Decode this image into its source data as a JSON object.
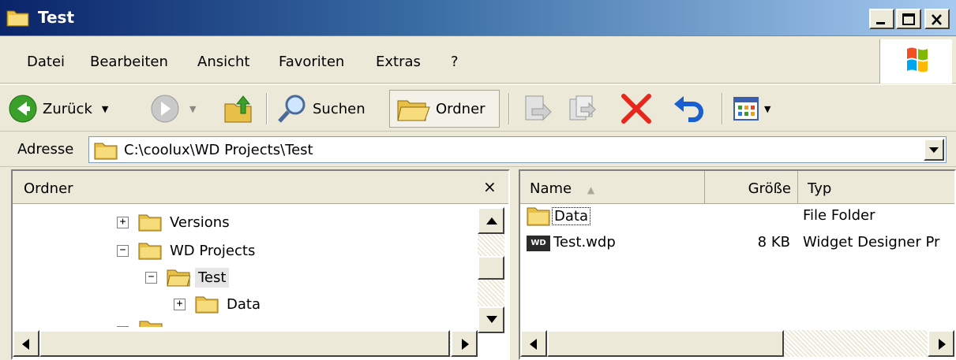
{
  "window": {
    "title": "Test",
    "minimize_icon": "minimize-icon",
    "maximize_icon": "maximize-icon",
    "close_icon": "close-icon"
  },
  "menu": {
    "items": [
      "Datei",
      "Bearbeiten",
      "Ansicht",
      "Favoriten",
      "Extras",
      "?"
    ]
  },
  "toolbar": {
    "back_label": "Zurück",
    "search_label": "Suchen",
    "folders_label": "Ordner"
  },
  "address": {
    "label": "Adresse",
    "path": "C:\\coolux\\WD Projects\\Test"
  },
  "left_panel": {
    "title": "Ordner",
    "close_glyph": "×",
    "tree": [
      {
        "label": "Versions",
        "expander": "+"
      },
      {
        "label": "WD Projects",
        "expander": "−"
      },
      {
        "label": "Test",
        "expander": "−"
      },
      {
        "label": "Data",
        "expander": "+"
      }
    ]
  },
  "right_panel": {
    "columns": {
      "name": "Name",
      "size": "Größe",
      "type": "Typ"
    },
    "files": [
      {
        "name": "Data",
        "size": "",
        "type": "File Folder",
        "icon": "folder-icon"
      },
      {
        "name": "Test.wdp",
        "size": "8 KB",
        "type": "Widget Designer Pr",
        "icon": "wd-file-icon",
        "icon_text": "WD"
      }
    ]
  },
  "colors": {
    "title_start": "#0a246a",
    "title_end": "#a6caf0",
    "chrome": "#ece9d8",
    "delete_red": "#e8261c"
  }
}
